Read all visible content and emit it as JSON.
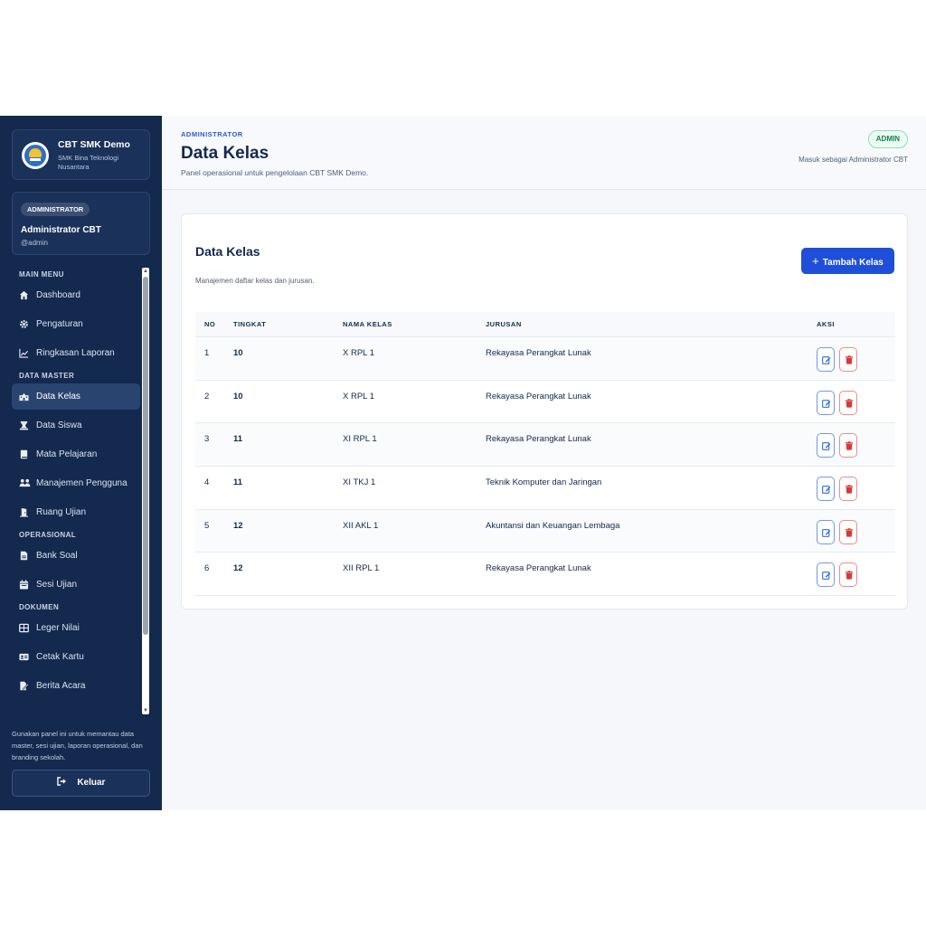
{
  "brand": {
    "title": "CBT SMK Demo",
    "subtitle": "SMK Bina Teknologi Nusantara"
  },
  "user": {
    "role": "ADMINISTRATOR",
    "name": "Administrator CBT",
    "handle": "@admin"
  },
  "menu": {
    "main_title": "MAIN MENU",
    "main": [
      {
        "label": "Dashboard",
        "icon": "home-icon"
      },
      {
        "label": "Pengaturan",
        "icon": "gear-icon"
      },
      {
        "label": "Ringkasan Laporan",
        "icon": "chart-line-icon"
      }
    ],
    "master_title": "DATA MASTER",
    "master": [
      {
        "label": "Data Kelas",
        "icon": "school-icon",
        "active": true
      },
      {
        "label": "Data Siswa",
        "icon": "student-icon"
      },
      {
        "label": "Mata Pelajaran",
        "icon": "book-icon"
      },
      {
        "label": "Manajemen Pengguna",
        "icon": "users-icon"
      },
      {
        "label": "Ruang Ujian",
        "icon": "door-icon"
      }
    ],
    "ops_title": "OPERASIONAL",
    "ops": [
      {
        "label": "Bank Soal",
        "icon": "file-icon"
      },
      {
        "label": "Sesi Ujian",
        "icon": "calendar-icon"
      }
    ],
    "doc_title": "DOKUMEN",
    "docs": [
      {
        "label": "Leger Nilai",
        "icon": "table-icon"
      },
      {
        "label": "Cetak Kartu",
        "icon": "id-card-icon"
      },
      {
        "label": "Berita Acara",
        "icon": "file-signature-icon"
      }
    ]
  },
  "sidebar_note": "Gunakan panel ini untuk memantau data master, sesi ujian, laporan operasional, dan branding sekolah.",
  "logout_label": "Keluar",
  "header": {
    "crumb": "ADMINISTRATOR",
    "title": "Data Kelas",
    "subtitle": "Panel operasional untuk pengelolaan CBT SMK Demo.",
    "badge": "ADMIN",
    "login_as": "Masuk sebagai Administrator CBT"
  },
  "card": {
    "title": "Data Kelas",
    "subtitle": "Manajemen daftar kelas dan jurusan.",
    "add_label": "Tambah Kelas"
  },
  "table": {
    "headers": {
      "no": "NO",
      "tingkat": "TINGKAT",
      "nama": "NAMA KELAS",
      "jurusan": "JURUSAN",
      "aksi": "AKSI"
    },
    "rows": [
      {
        "no": "1",
        "tingkat": "10",
        "nama": "X RPL 1",
        "jurusan": "Rekayasa Perangkat Lunak"
      },
      {
        "no": "2",
        "tingkat": "10",
        "nama": "X RPL 1",
        "jurusan": "Rekayasa Perangkat Lunak"
      },
      {
        "no": "3",
        "tingkat": "11",
        "nama": "XI RPL 1",
        "jurusan": "Rekayasa Perangkat Lunak"
      },
      {
        "no": "4",
        "tingkat": "11",
        "nama": "XI TKJ 1",
        "jurusan": "Teknik Komputer dan Jaringan"
      },
      {
        "no": "5",
        "tingkat": "12",
        "nama": "XII AKL 1",
        "jurusan": "Akuntansi dan Keuangan Lembaga"
      },
      {
        "no": "6",
        "tingkat": "12",
        "nama": "XII RPL 1",
        "jurusan": "Rekayasa Perangkat Lunak"
      }
    ]
  },
  "colors": {
    "sidebar": "#13294d",
    "accent": "#1f4fd8",
    "danger": "#d93636",
    "success": "#16804b"
  }
}
